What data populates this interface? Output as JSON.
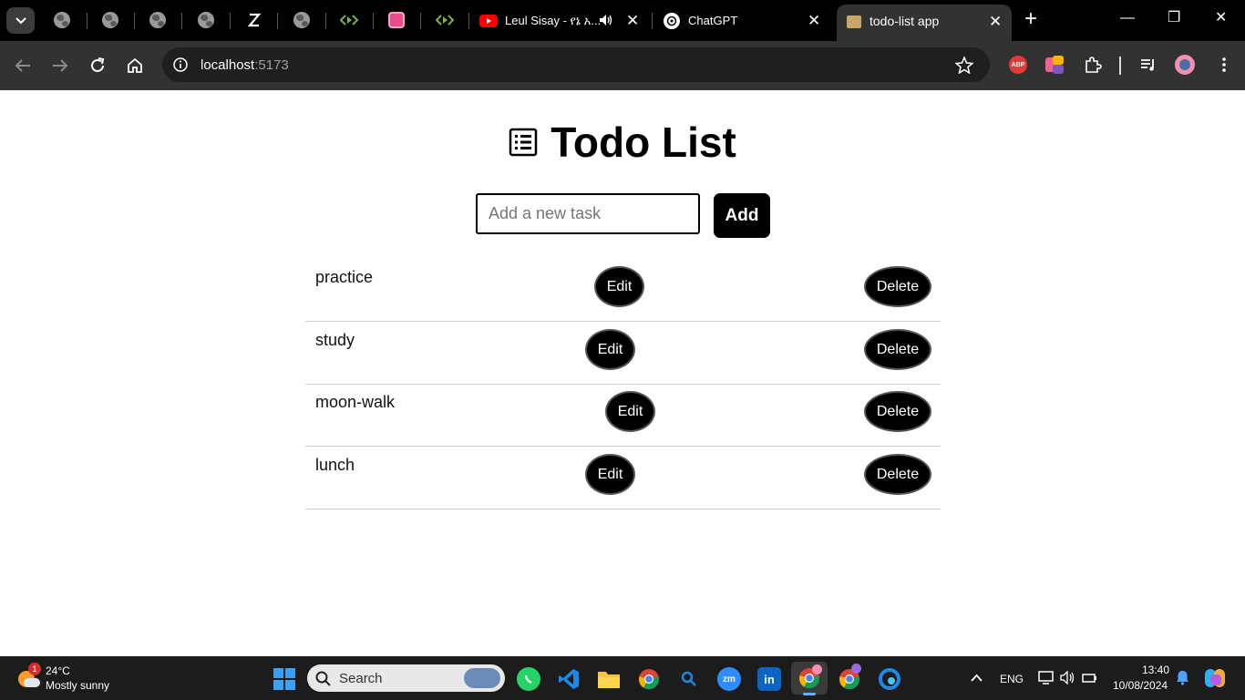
{
  "browser": {
    "tabs": [
      {
        "title": "Leul Sisay - የኔ አ..."
      },
      {
        "title": "ChatGPT"
      },
      {
        "title": "todo-list app"
      }
    ],
    "address": {
      "host": "localhost",
      "port": ":5173"
    },
    "ext_badge": "ABP"
  },
  "app": {
    "title": "Todo List",
    "input_placeholder": "Add a new task",
    "add_label": "Add",
    "edit_label": "Edit",
    "delete_label": "Delete",
    "todos": [
      {
        "text": "practice"
      },
      {
        "text": "study"
      },
      {
        "text": "moon-walk"
      },
      {
        "text": "lunch"
      }
    ]
  },
  "taskbar": {
    "weather_temp": "24°C",
    "weather_desc": "Mostly sunny",
    "weather_badge": "1",
    "search_placeholder": "Search",
    "lang": "ENG",
    "time": "13:40",
    "date": "10/08/2024"
  },
  "colors": {
    "page_bg": "#ffffff",
    "button_bg": "#000000",
    "chrome_bg": "#323232"
  }
}
